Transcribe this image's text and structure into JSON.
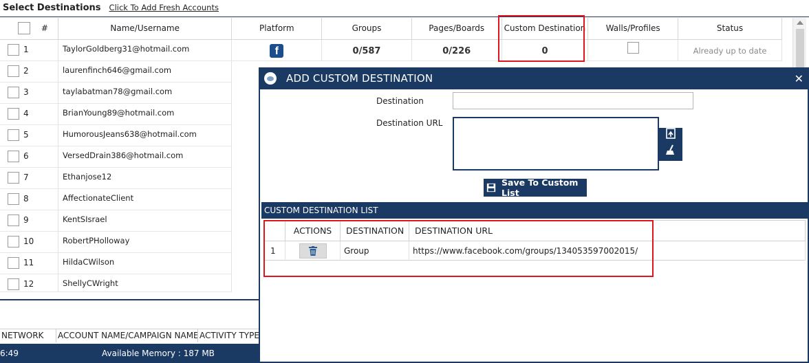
{
  "header": {
    "title": "Select Destinations",
    "add_link": "Click To Add Fresh Accounts"
  },
  "table": {
    "columns": {
      "num": "#",
      "name": "Name/Username",
      "platform": "Platform",
      "groups": "Groups",
      "pages": "Pages/Boards",
      "custom": "Custom Destination",
      "walls": "Walls/Profiles",
      "status": "Status"
    },
    "rows": [
      {
        "num": "1",
        "name": "TaylorGoldberg31@hotmail.com",
        "groups": "0/587",
        "pages": "0/226",
        "custom": "0",
        "status": "Already up to date"
      },
      {
        "num": "2",
        "name": "laurenfinch646@gmail.com"
      },
      {
        "num": "3",
        "name": "taylabatman78@gmail.com"
      },
      {
        "num": "4",
        "name": "BrianYoung89@hotmail.com"
      },
      {
        "num": "5",
        "name": "HumorousJeans638@hotmail.com"
      },
      {
        "num": "6",
        "name": "VersedDrain386@hotmail.com"
      },
      {
        "num": "7",
        "name": "Ethanjose12"
      },
      {
        "num": "8",
        "name": "AffectionateClient"
      },
      {
        "num": "9",
        "name": "KentSIsrael"
      },
      {
        "num": "10",
        "name": "RobertPHolloway"
      },
      {
        "num": "11",
        "name": "HildaCWilson"
      },
      {
        "num": "12",
        "name": "ShellyCWright"
      }
    ],
    "platform_icon": "facebook-icon"
  },
  "bottom": {
    "columns": {
      "network": "NETWORK",
      "account": "ACCOUNT NAME/CAMPAIGN NAME",
      "activity": "ACTIVITY TYPE"
    }
  },
  "status_bar": {
    "time": "6:49",
    "memory": "Available Memory : 187  MB"
  },
  "modal": {
    "title": "ADD CUSTOM DESTINATION",
    "destination_label": "Destination",
    "destination_value": "",
    "url_label": "Destination URL",
    "url_value": "",
    "save_label": "Save To Custom List",
    "list_title": "CUSTOM DESTINATION LIST",
    "list_columns": {
      "actions": "ACTIONS",
      "destination": "DESTINATION",
      "url": "DESTINATION URL"
    },
    "list_rows": [
      {
        "num": "1",
        "destination": "Group",
        "url": "https://www.facebook.com/groups/134053597002015/"
      }
    ]
  },
  "colors": {
    "navy": "#1b3a63",
    "highlight": "#e0141e",
    "facebook": "#1c4d8c"
  }
}
